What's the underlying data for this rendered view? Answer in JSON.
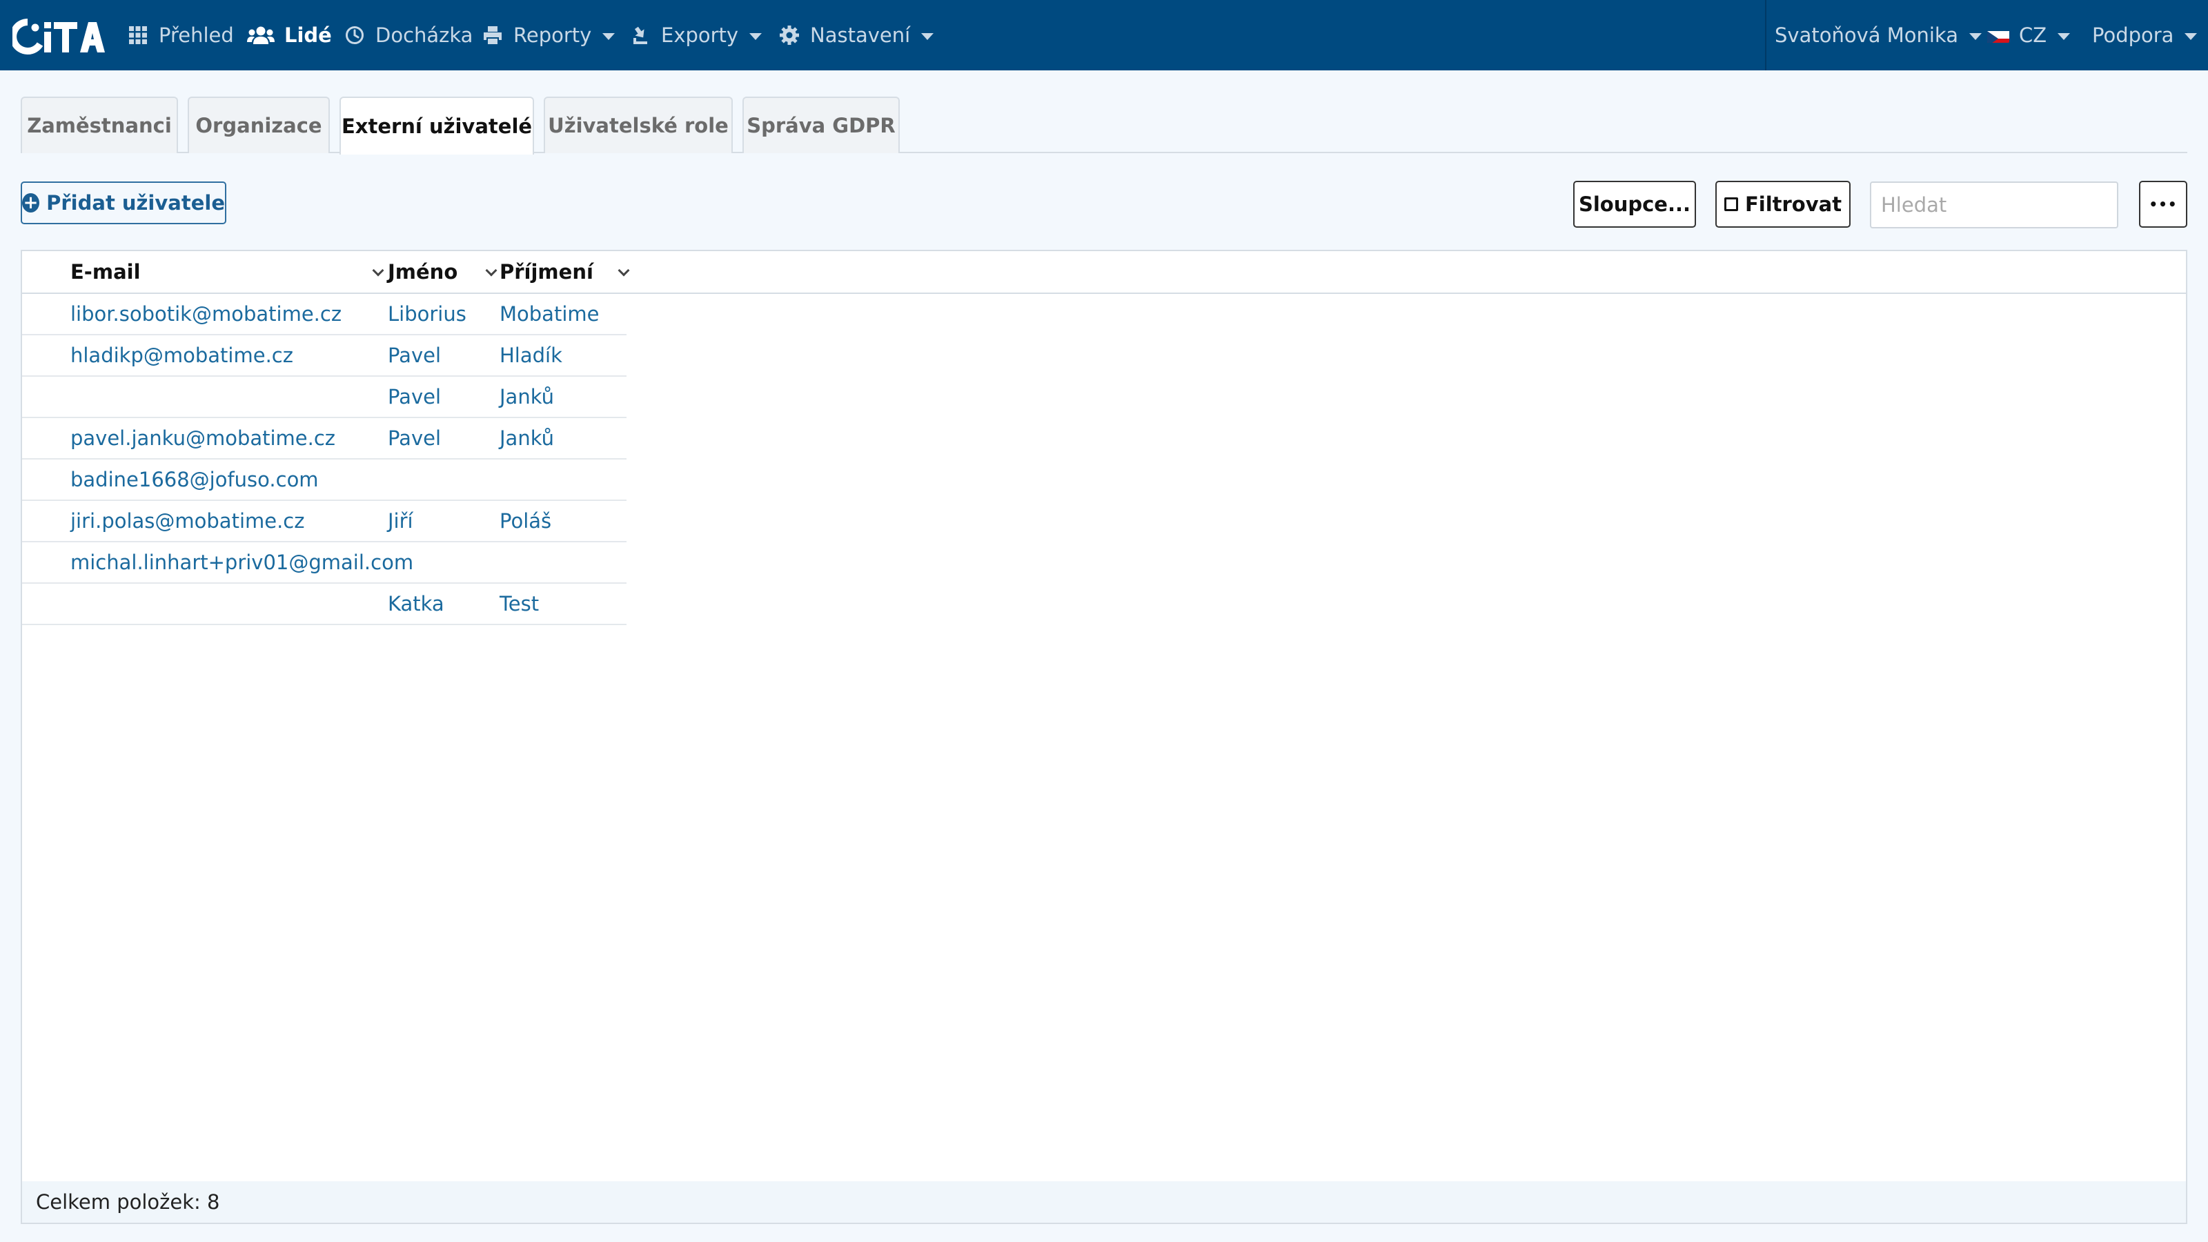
{
  "navbar": {
    "brand": "CiTA",
    "items": [
      {
        "label": "Přehled",
        "icon": "grid-icon"
      },
      {
        "label": "Lidé",
        "icon": "users-icon",
        "active": true
      },
      {
        "label": "Docházka",
        "icon": "clock-icon"
      },
      {
        "label": "Reporty",
        "icon": "print-icon"
      },
      {
        "label": "Exporty",
        "icon": "export-icon"
      },
      {
        "label": "Nastavení",
        "icon": "gear-icon"
      }
    ],
    "user": "Svatoňová Monika",
    "language": "CZ",
    "support": "Podpora"
  },
  "tabs": [
    {
      "label": "Zaměstnanci"
    },
    {
      "label": "Organizace"
    },
    {
      "label": "Externí uživatelé",
      "active": true
    },
    {
      "label": "Uživatelské role"
    },
    {
      "label": "Správa GDPR"
    }
  ],
  "toolbar": {
    "add_label": "Přidat uživatele",
    "columns_label": "Sloupce...",
    "filter_label": "Filtrovat",
    "search_placeholder": "Hledat",
    "more_label": "•••"
  },
  "table": {
    "columns": [
      "E-mail",
      "Jméno",
      "Příjmení"
    ],
    "rows": [
      {
        "email": "libor.sobotik@mobatime.cz",
        "first": "Liborius",
        "last": "Mobatime"
      },
      {
        "email": "hladikp@mobatime.cz",
        "first": "Pavel",
        "last": "Hladík"
      },
      {
        "email": "",
        "first": "Pavel",
        "last": "Janků"
      },
      {
        "email": "pavel.janku@mobatime.cz",
        "first": "Pavel",
        "last": "Janků"
      },
      {
        "email": "badine1668@jofuso.com",
        "first": "",
        "last": ""
      },
      {
        "email": "jiri.polas@mobatime.cz",
        "first": "Jiří",
        "last": "Poláš"
      },
      {
        "email": "michal.linhart+priv01@gmail.com",
        "first": "",
        "last": ""
      },
      {
        "email": "",
        "first": "Katka",
        "last": "Test"
      }
    ],
    "footer": "Celkem položek: 8"
  },
  "colors": {
    "navbar": "#004a80",
    "link": "#1b6a9e",
    "background": "#f3f8fd"
  }
}
